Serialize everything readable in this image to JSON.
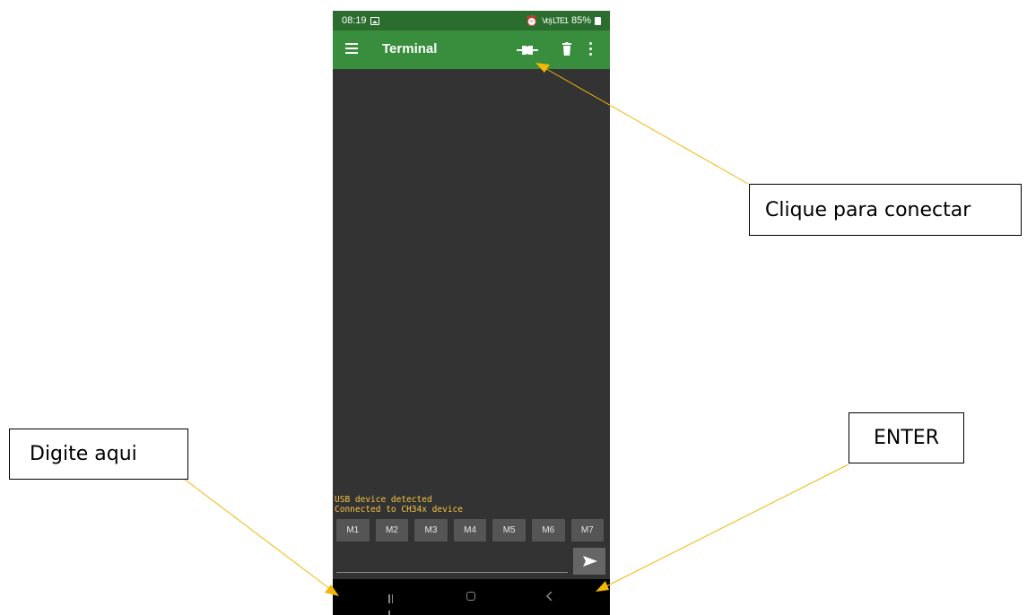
{
  "status_bar": {
    "time": "08:19",
    "signal_text": "Vo) LTE1",
    "battery": "85%"
  },
  "toolbar": {
    "title": "Terminal",
    "menu_icon": "hamburger-icon",
    "connect_icon": "plug-connect-icon",
    "delete_icon": "trash-icon",
    "more_icon": "overflow-menu-icon"
  },
  "terminal": {
    "lines": [
      "USB device detected",
      "Connected to CH34x device"
    ],
    "text_color": "#f5c542"
  },
  "macros": [
    "M1",
    "M2",
    "M3",
    "M4",
    "M5",
    "M6",
    "M7"
  ],
  "input": {
    "value": "",
    "placeholder": ""
  },
  "send_button": {
    "icon": "send-arrow-icon"
  },
  "annotations": {
    "connect": "Clique para conectar",
    "type_here": "Digite aqui",
    "enter": "ENTER",
    "arrow_color": "#f2b705"
  },
  "colors": {
    "toolbar": "#388e3c",
    "status_bar": "#2b6d2f",
    "background": "#333333"
  }
}
